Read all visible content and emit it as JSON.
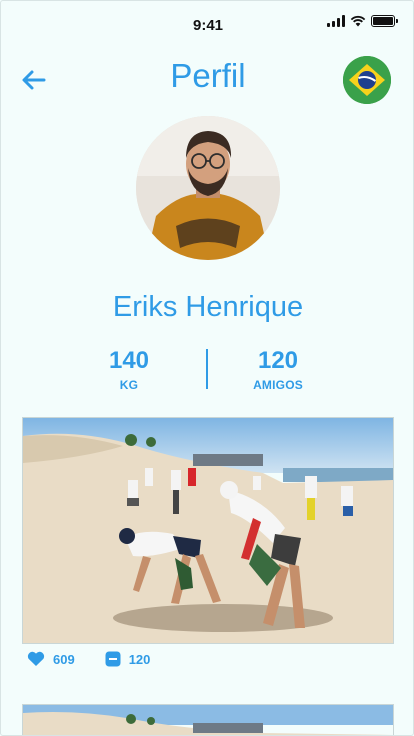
{
  "status_bar": {
    "time": "9:41"
  },
  "header": {
    "title": "Perfil",
    "back_icon": "arrow-left-icon",
    "flag_icon": "brazil-flag-icon"
  },
  "profile": {
    "name": "Eriks Henrique",
    "stats": [
      {
        "value": "140",
        "label": "KG"
      },
      {
        "value": "120",
        "label": "AMIGOS"
      }
    ]
  },
  "posts": [
    {
      "likes": "609",
      "comments": "120",
      "like_icon": "heart-icon",
      "comment_icon": "comment-icon"
    }
  ],
  "colors": {
    "accent": "#2f9be6",
    "background": "#f3fdfc"
  }
}
